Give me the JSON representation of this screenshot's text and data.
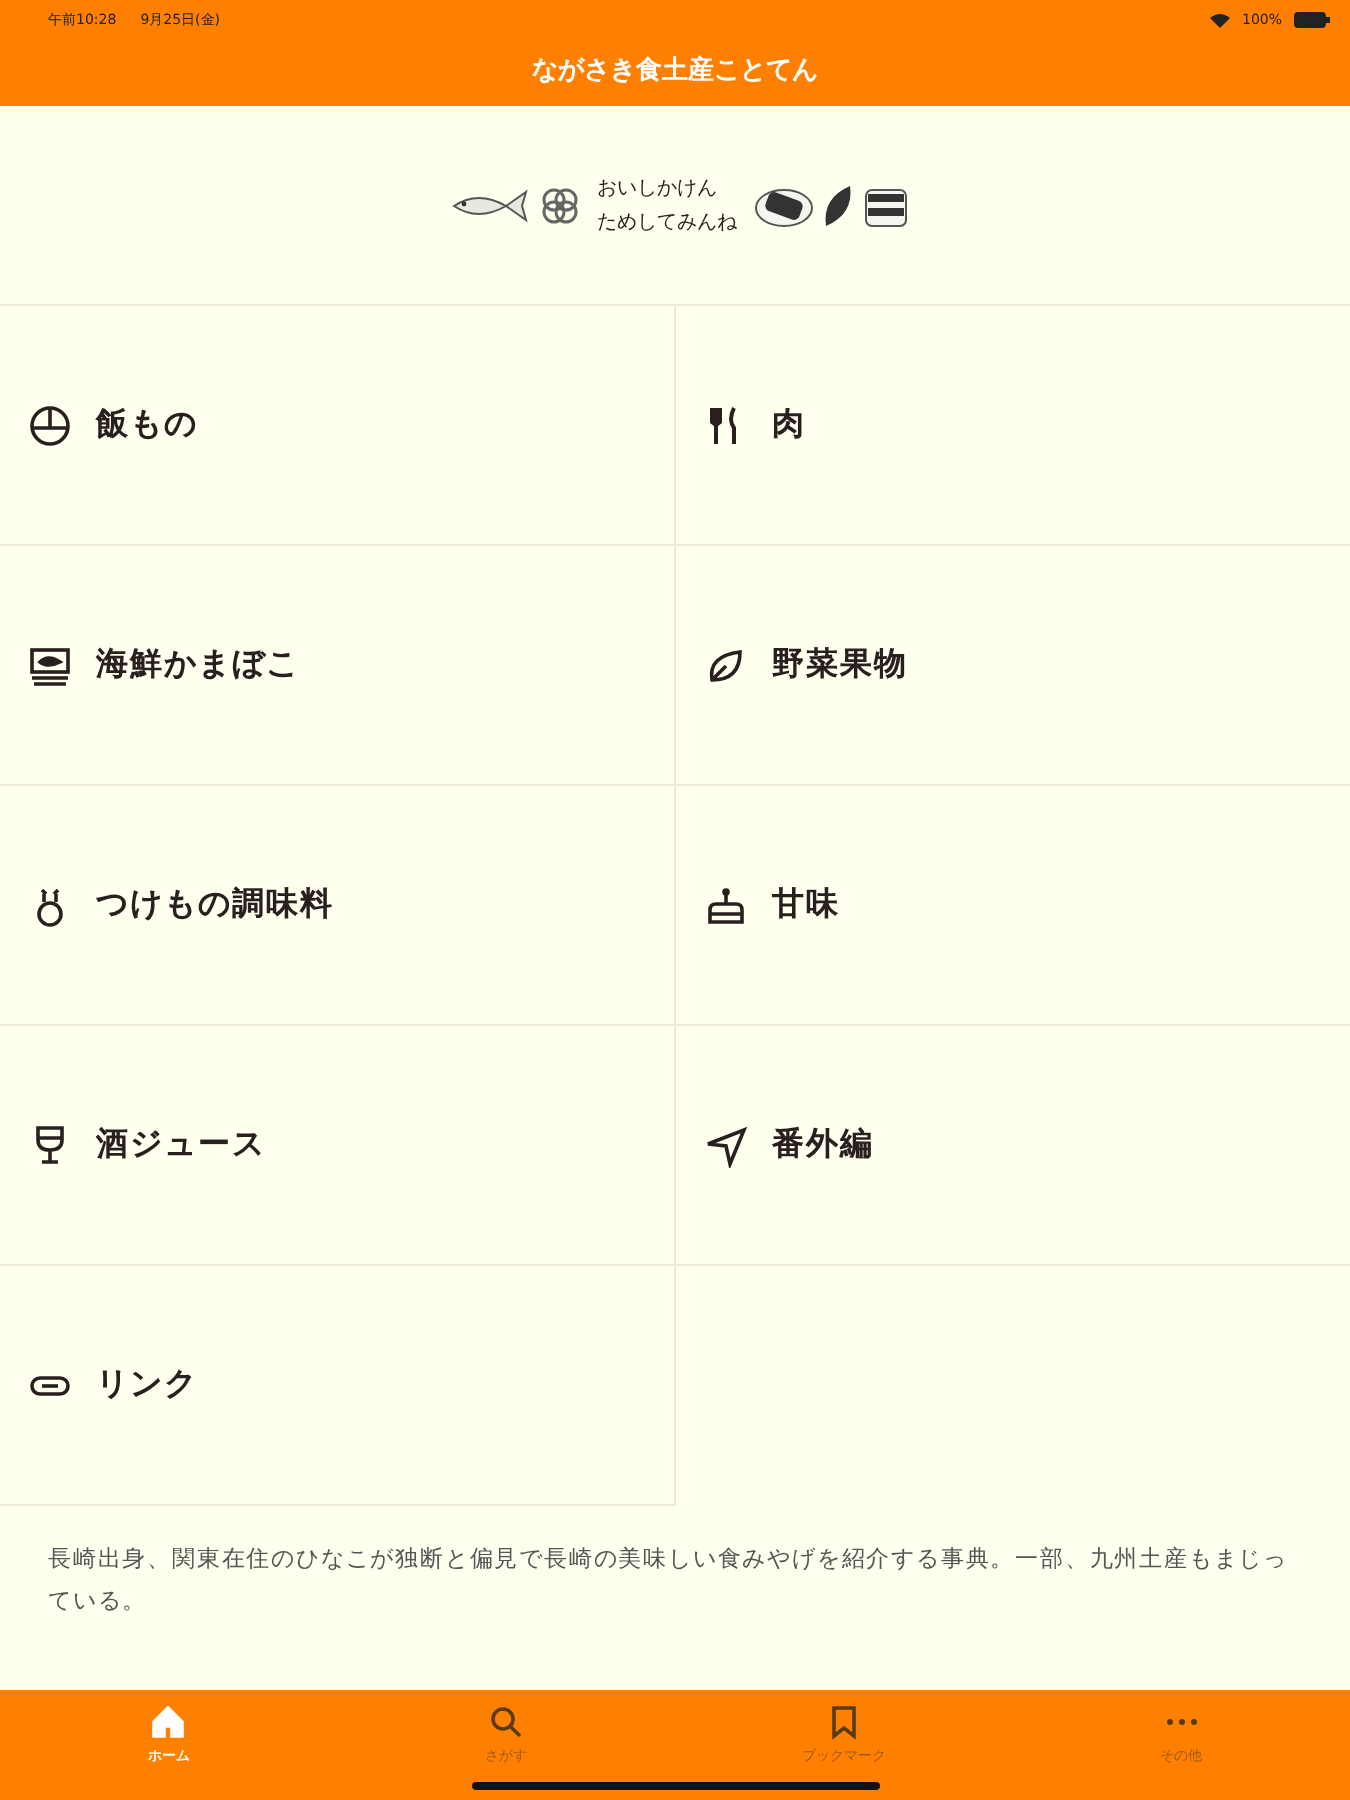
{
  "status_bar": {
    "time": "午前10:28",
    "date": "9月25日(金)",
    "battery": "100%"
  },
  "header": {
    "title": "ながさき食土産ことてん"
  },
  "banner": {
    "lines": [
      "おいしかけん",
      "ためしてみんね"
    ]
  },
  "categories": [
    {
      "label": "飯もの",
      "kind": "rice"
    },
    {
      "label": "肉",
      "kind": "cutlery"
    },
    {
      "label": "海鮮かまぼこ",
      "kind": "seafood"
    },
    {
      "label": "野菜果物",
      "kind": "leaf"
    },
    {
      "label": "つけもの調味料",
      "kind": "jar"
    },
    {
      "label": "甘味",
      "kind": "cake"
    },
    {
      "label": "酒ジュース",
      "kind": "glass"
    },
    {
      "label": "番外編",
      "kind": "send"
    },
    {
      "label": "リンク",
      "kind": "link"
    }
  ],
  "description": "長崎出身、関東在住のひなこが独断と偏見で長崎の美味しい食みやげを紹介する事典。一部、九州土産もまじっている。",
  "tab_bar": [
    {
      "label": "ホーム",
      "kind": "home",
      "selected": true
    },
    {
      "label": "さがす",
      "kind": "search",
      "selected": false
    },
    {
      "label": "ブックマーク",
      "kind": "bookmark",
      "selected": false
    },
    {
      "label": "その他",
      "kind": "more",
      "selected": false
    }
  ]
}
